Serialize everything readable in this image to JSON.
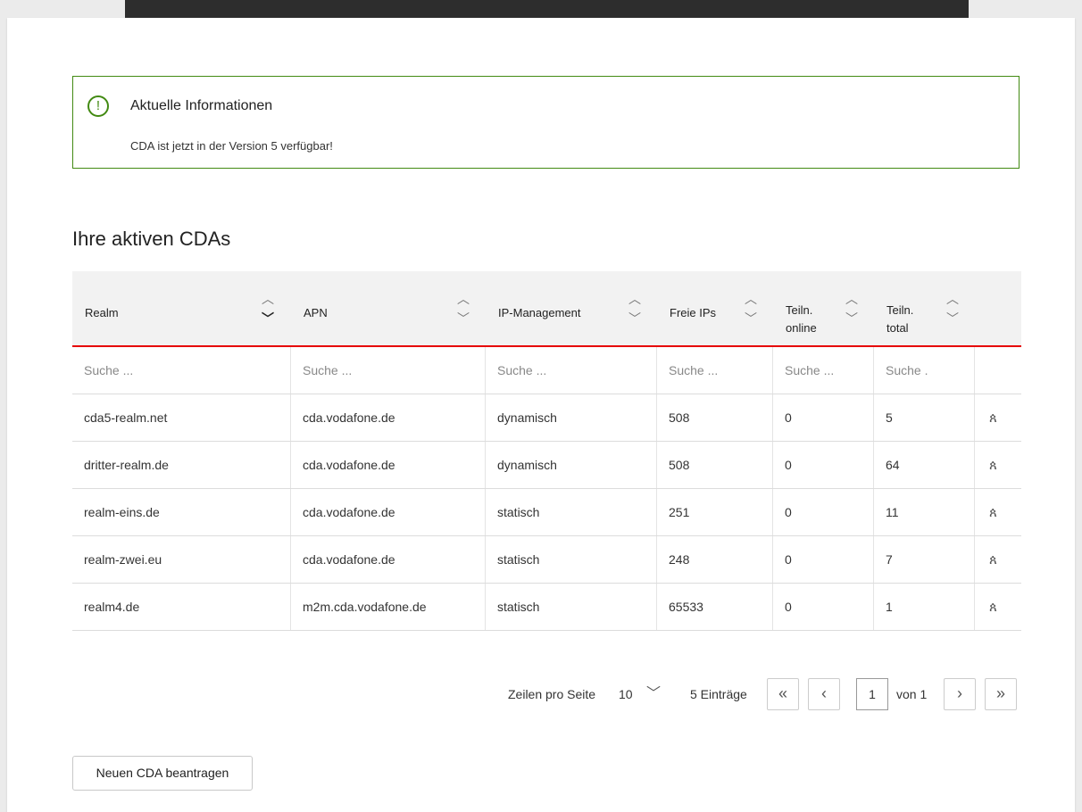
{
  "info": {
    "title": "Aktuelle Informationen",
    "text": "CDA ist jetzt in der Version 5 verfügbar!",
    "accent_color": "#428a12"
  },
  "section_title": "Ihre aktiven CDAs",
  "table": {
    "headers": [
      {
        "line1": "Realm",
        "line2": ""
      },
      {
        "line1": "APN",
        "line2": ""
      },
      {
        "line1": "IP-Management",
        "line2": ""
      },
      {
        "line1": "Freie IPs",
        "line2": ""
      },
      {
        "line1": "Teiln.",
        "line2": "online"
      },
      {
        "line1": "Teiln.",
        "line2": "total"
      }
    ],
    "search_placeholders": [
      "Suche ...",
      "Suche ...",
      "Suche ...",
      "Suche ...",
      "Suche ...",
      "Suche ."
    ],
    "rows": [
      {
        "realm": "cda5-realm.net",
        "apn": "cda.vodafone.de",
        "ip_mgmt": "dynamisch",
        "free_ips": "508",
        "online": "0",
        "total": "5"
      },
      {
        "realm": "dritter-realm.de",
        "apn": "cda.vodafone.de",
        "ip_mgmt": "dynamisch",
        "free_ips": "508",
        "online": "0",
        "total": "64"
      },
      {
        "realm": "realm-eins.de",
        "apn": "cda.vodafone.de",
        "ip_mgmt": "statisch",
        "free_ips": "251",
        "online": "0",
        "total": "11"
      },
      {
        "realm": "realm-zwei.eu",
        "apn": "cda.vodafone.de",
        "ip_mgmt": "statisch",
        "free_ips": "248",
        "online": "0",
        "total": "7"
      },
      {
        "realm": "realm4.de",
        "apn": "m2m.cda.vodafone.de",
        "ip_mgmt": "statisch",
        "free_ips": "65533",
        "online": "0",
        "total": "1"
      }
    ],
    "row_icon": "users-icon",
    "header_underline_color": "#e60000"
  },
  "pagination": {
    "rows_per_page_label": "Zeilen pro Seite",
    "rows_per_page_value": "10",
    "entries": "5 Einträge",
    "current_page": "1",
    "of_label": "von 1"
  },
  "new_button_label": "Neuen CDA beantragen"
}
